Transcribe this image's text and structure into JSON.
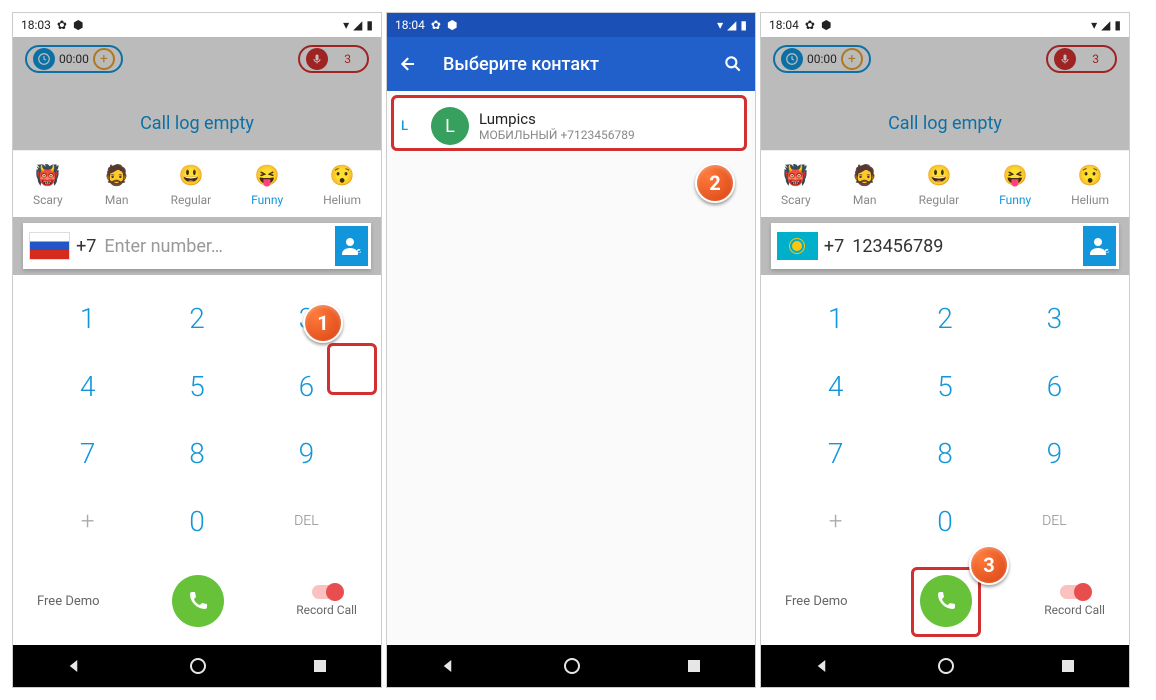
{
  "screens": [
    {
      "status_time": "18:03",
      "timer_text": "00:00",
      "record_count": "3",
      "call_log": "Call log empty",
      "voices": [
        "Scary",
        "Man",
        "Regular",
        "Funny",
        "Helium"
      ],
      "voice_active_index": 3,
      "flag": "ru",
      "prefix": "+7",
      "number_value": "",
      "number_placeholder": "Enter number…",
      "keypad": [
        "1",
        "2",
        "3",
        "4",
        "5",
        "6",
        "7",
        "8",
        "9",
        "+",
        "0",
        "DEL"
      ],
      "free_demo": "Free Demo",
      "record_call": "Record Call",
      "annotation_badge": "1"
    },
    {
      "status_time": "18:04",
      "appbar_title": "Выберите контакт",
      "contact": {
        "section": "L",
        "initial": "L",
        "name": "Lumpics",
        "sub": "МОБИЛЬНЫЙ +7123456789"
      },
      "annotation_badge": "2"
    },
    {
      "status_time": "18:04",
      "timer_text": "00:00",
      "record_count": "3",
      "call_log": "Call log empty",
      "voices": [
        "Scary",
        "Man",
        "Regular",
        "Funny",
        "Helium"
      ],
      "voice_active_index": 3,
      "flag": "kz",
      "prefix": "+7",
      "number_value": "123456789",
      "number_placeholder": "",
      "keypad": [
        "1",
        "2",
        "3",
        "4",
        "5",
        "6",
        "7",
        "8",
        "9",
        "+",
        "0",
        "DEL"
      ],
      "free_demo": "Free Demo",
      "record_call": "Record Call",
      "annotation_badge": "3"
    }
  ]
}
